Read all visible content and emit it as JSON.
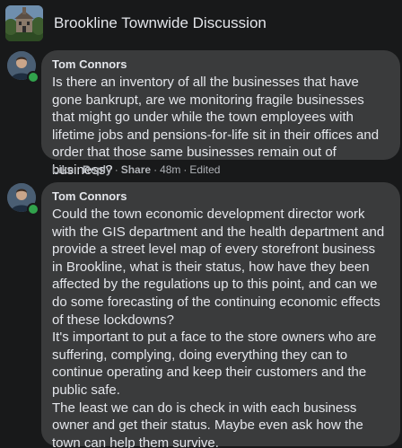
{
  "group": {
    "title": "Brookline Townwide Discussion"
  },
  "comments": [
    {
      "author": "Tom Connors",
      "text": "Is there an inventory of all the businesses that have gone bankrupt, are we monitoring fragile businesses that might go under while the town employees with lifetime jobs and pensions-for-life sit in their offices and order that those same businesses remain out of business?",
      "actions": {
        "like": "Like",
        "reply": "Reply",
        "share": "Share",
        "time": "48m",
        "edited": "Edited"
      }
    },
    {
      "author": "Tom Connors",
      "text": "Could the town economic development director work with the GIS department and the health department and provide a street level map of every storefront business in Brookline, what is their status, how have they been affected by the regulations up to this point, and can we do some forecasting of the continuing economic effects of these lockdowns?\nIt's important to put a face to the store owners who are suffering, complying, doing everything they can to continue operating and keep their customers and the public safe.\nThe least we can do is check in with each business owner and get their status. Maybe even ask how the town can help them survive."
    }
  ],
  "colors": {
    "background": "#18191a",
    "bubble": "#3a3b3c",
    "text": "#e4e6eb",
    "secondary_text": "#b0b3b8",
    "online": "#31a24c"
  }
}
